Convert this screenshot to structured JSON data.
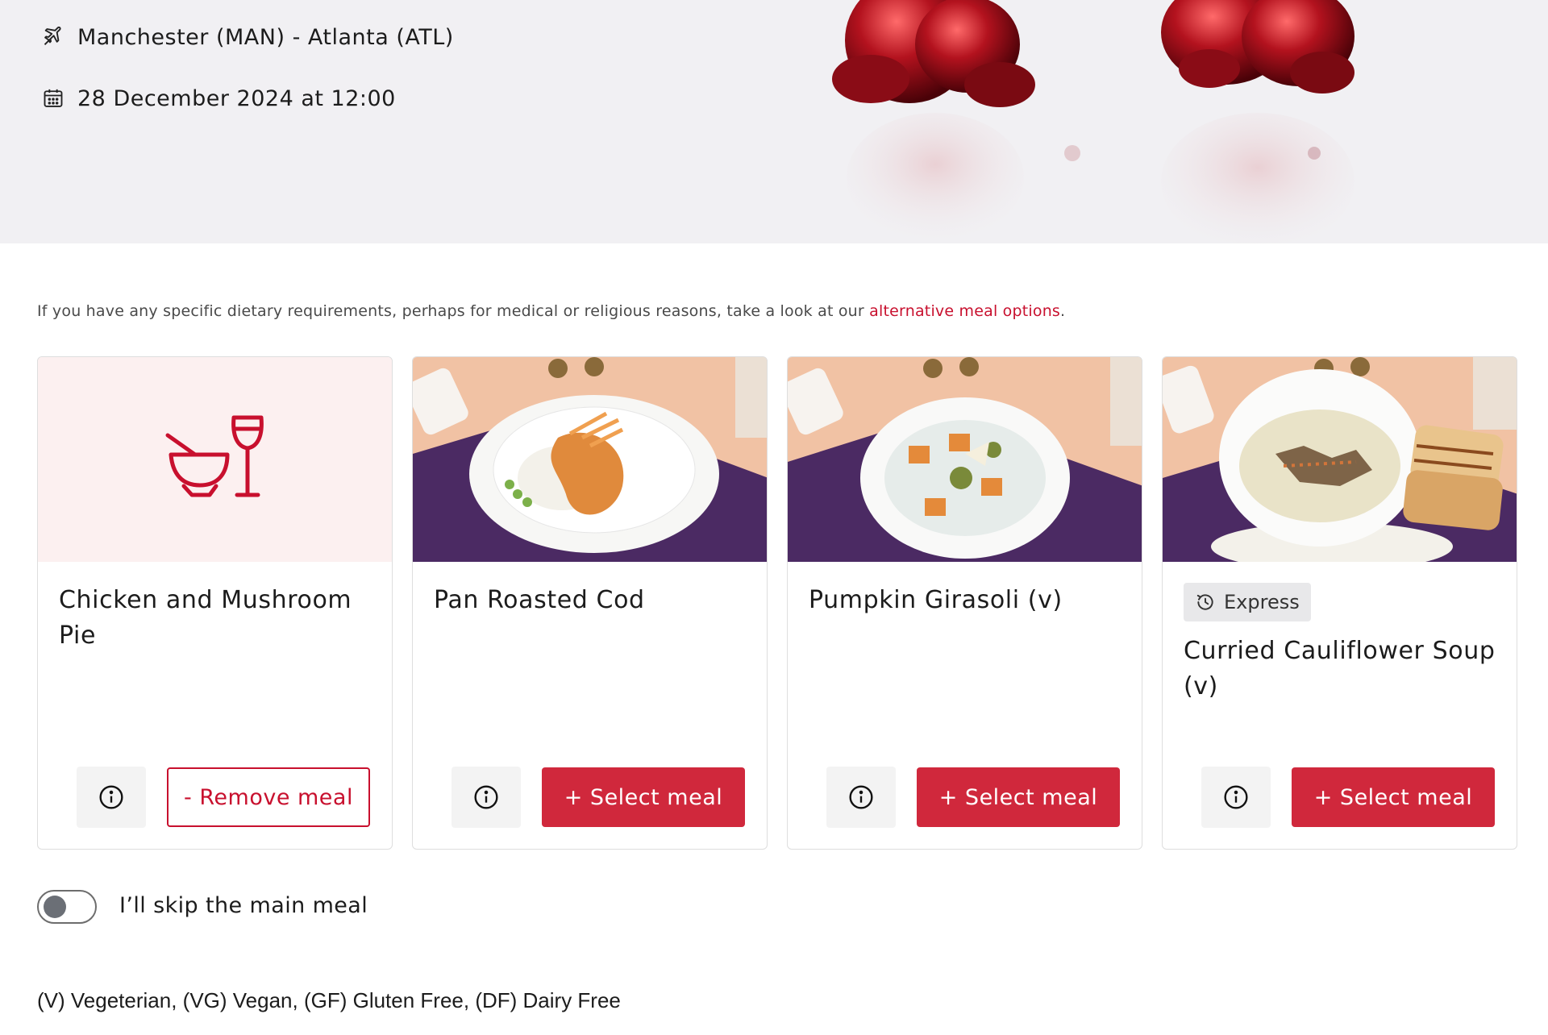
{
  "flight": {
    "route": "Manchester (MAN) - Atlanta (ATL)",
    "datetime": "28 December 2024 at 12:00"
  },
  "notice": {
    "text": "If you have any specific dietary requirements, perhaps for medical or religious reasons, take a look at our ",
    "link": "alternative meal options",
    "suffix": "."
  },
  "meals": [
    {
      "name": "Chicken and Mushroom Pie",
      "action": "- Remove meal",
      "state": "selected",
      "image": "meal-placeholder-icon"
    },
    {
      "name": "Pan Roasted Cod",
      "action": "+ Select meal",
      "state": "available",
      "image": "fish-curry-rice-dish"
    },
    {
      "name": "Pumpkin Girasoli (v)",
      "action": "+ Select meal",
      "state": "available",
      "image": "pasta-pumpkin-dish"
    },
    {
      "name": "Curried Cauliflower Soup (v)",
      "action": "+ Select meal",
      "state": "available",
      "badge": "Express",
      "image": "soup-with-toastie"
    }
  ],
  "skip_toggle": {
    "label": "I’ll skip the main meal",
    "on": false
  },
  "legend": "(V) Vegeterian, (VG) Vegan, (GF) Gluten Free, (DF) Dairy Free",
  "colors": {
    "accent": "#d0283c",
    "link": "#c8102e",
    "hero_bg": "#f1f0f3",
    "placeholder_bg": "#fcf0f0"
  }
}
